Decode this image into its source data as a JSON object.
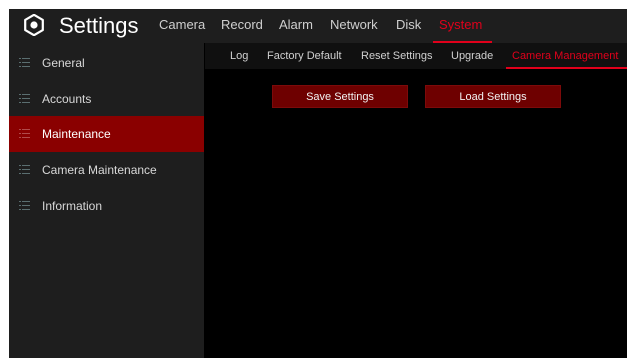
{
  "app": {
    "title": "Settings",
    "icon": "gear-icon"
  },
  "top_menu": [
    {
      "label": "Camera",
      "active": false
    },
    {
      "label": "Record",
      "active": false
    },
    {
      "label": "Alarm",
      "active": false
    },
    {
      "label": "Network",
      "active": false
    },
    {
      "label": "Disk",
      "active": false
    },
    {
      "label": "System",
      "active": true
    }
  ],
  "sidebar": {
    "items": [
      {
        "label": "General",
        "icon": "list-icon",
        "active": false
      },
      {
        "label": "Accounts",
        "icon": "list-icon",
        "active": false
      },
      {
        "label": "Maintenance",
        "icon": "list-icon",
        "active": true
      },
      {
        "label": "Camera Maintenance",
        "icon": "list-icon",
        "active": false
      },
      {
        "label": "Information",
        "icon": "list-icon",
        "active": false
      }
    ]
  },
  "subtabs": [
    {
      "label": "Log",
      "active": false
    },
    {
      "label": "Factory Default",
      "active": false
    },
    {
      "label": "Reset Settings",
      "active": false
    },
    {
      "label": "Upgrade",
      "active": false
    },
    {
      "label": "Camera Management",
      "active": true
    }
  ],
  "buttons": {
    "save": "Save Settings",
    "load": "Load Settings"
  },
  "colors": {
    "accent": "#e0001b",
    "active_bg": "#8a0000",
    "button_bg": "#6e0000",
    "panel_bg": "#1e1e1e",
    "content_bg": "#000000"
  }
}
